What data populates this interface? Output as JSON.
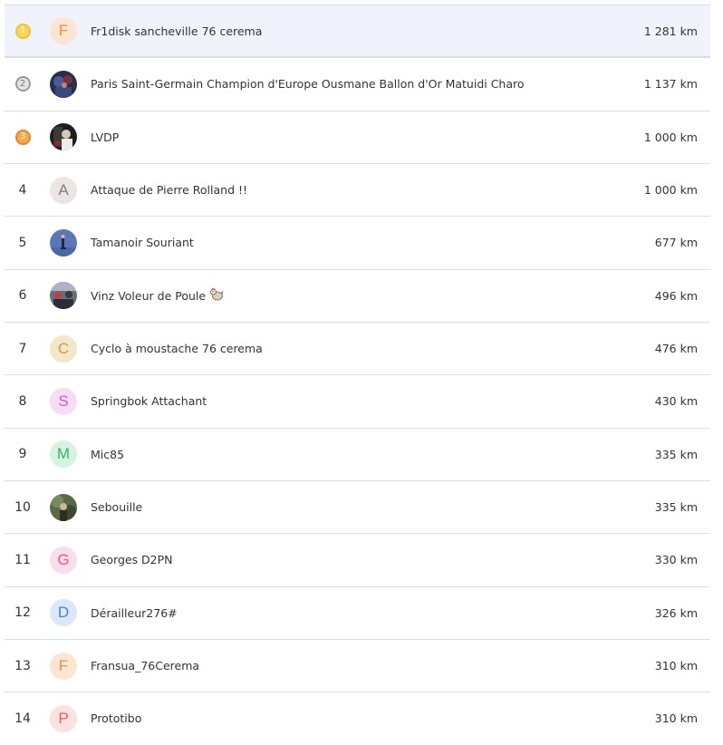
{
  "leaderboard": {
    "unit": "km",
    "rows": [
      {
        "rank": "1",
        "name": "Fr1disk sancheville 76 cerema",
        "distance": "1 281 km"
      },
      {
        "rank": "2",
        "name": "Paris Saint-Germain Champion d'Europe Ousmane Ballon d'Or Matuidi Charo",
        "distance": "1 137 km"
      },
      {
        "rank": "3",
        "name": "LVDP",
        "distance": "1 000 km"
      },
      {
        "rank": "4",
        "name": "Attaque de Pierre Rolland !!",
        "distance": "1 000 km",
        "initial": "A"
      },
      {
        "rank": "5",
        "name": "Tamanoir Souriant",
        "distance": "677 km"
      },
      {
        "rank": "6",
        "name": "Vinz Voleur de Poule",
        "distance": "496 km"
      },
      {
        "rank": "7",
        "name": "Cyclo à moustache 76 cerema",
        "distance": "476 km",
        "initial": "C"
      },
      {
        "rank": "8",
        "name": "Springbok Attachant",
        "distance": "430 km",
        "initial": "S"
      },
      {
        "rank": "9",
        "name": "Mic85",
        "distance": "335 km",
        "initial": "M"
      },
      {
        "rank": "10",
        "name": "Sebouille",
        "distance": "335 km"
      },
      {
        "rank": "11",
        "name": "Georges D2PN",
        "distance": "330 km",
        "initial": "G"
      },
      {
        "rank": "12",
        "name": "Dérailleur276#",
        "distance": "326 km",
        "initial": "D"
      },
      {
        "rank": "13",
        "name": "Fransua_76Cerema",
        "distance": "310 km",
        "initial": "F"
      },
      {
        "rank": "14",
        "name": "Prototibo",
        "distance": "310 km",
        "initial": "P"
      }
    ],
    "first_initial": "F"
  },
  "colors": {
    "highlight_row": "#f0f3fc",
    "gold": "#f2c230",
    "silver": "#9a9a9a",
    "bronze": "#e8862a",
    "avatar_f_bg": "#fde5d2",
    "avatar_f_fg": "#e8904a",
    "avatar_a_bg": "#ebe6e3",
    "avatar_a_fg": "#8a7a72",
    "avatar_c_bg": "#f3e7c8",
    "avatar_c_fg": "#c8a040",
    "avatar_s_bg": "#f8dcf6",
    "avatar_s_fg": "#c45fc0",
    "avatar_m_bg": "#d6f3e2",
    "avatar_m_fg": "#3bb070",
    "avatar_g_bg": "#fbdcea",
    "avatar_g_fg": "#e05a98",
    "avatar_d_bg": "#dbe7fb",
    "avatar_d_fg": "#4a7fd8",
    "avatar_p_bg": "#fde0e0",
    "avatar_p_fg": "#e06060"
  },
  "icons": {
    "medal_1": "gold-medal-icon",
    "medal_2": "silver-medal-icon",
    "medal_3": "bronze-medal-icon",
    "hen": "hen-emoji-icon"
  }
}
